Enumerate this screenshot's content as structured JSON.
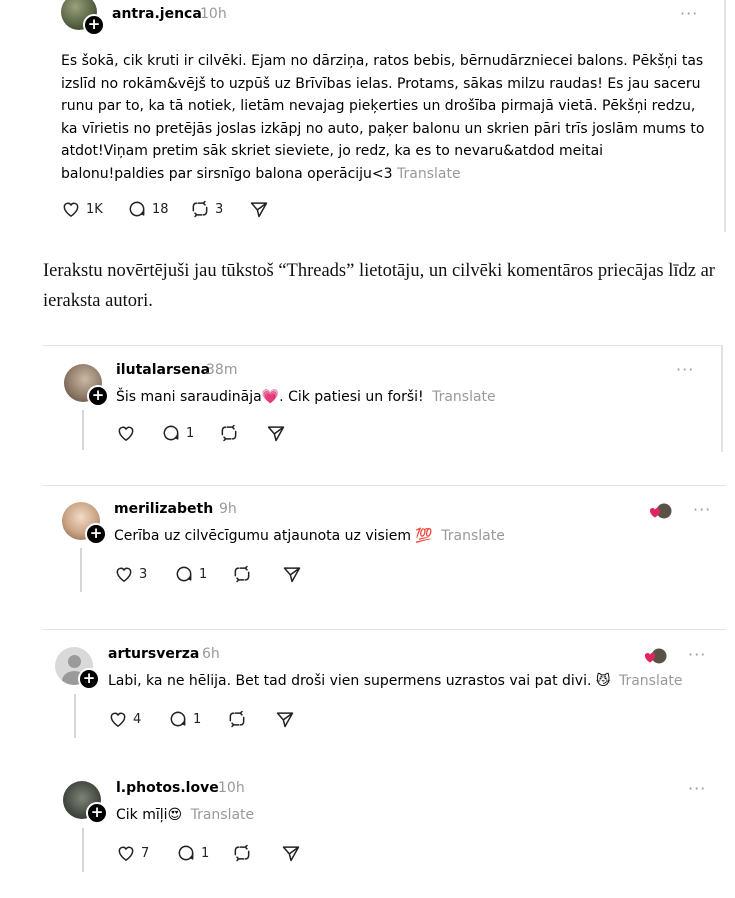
{
  "post": {
    "username": "antra.jenca",
    "time": "10h",
    "text": "Es šokā, cik kruti ir cilvēki. Ejam no dārziņa, ratos bebis, bērnudārzniecei balons. Pēkšņi tas izslīd no rokām&vējš to uzpūš uz Brīvības ielas. Protams, sākas milzu raudas! Es jau saceru runu par to, ka tā notiek, lietām nevajag pieķerties un drošība pirmajā vietā. Pēkšņi redzu, ka vīrietis no pretējās joslas izkāpj no auto, paķer balonu un skrien pāri trīs joslām mums to atdot!Viņam pretim sāk skriet sieviete, jo redz, ka es to nevaru&atdod meitai balonu!paldies par sirsnīgo balona operāciju<3",
    "translate": "Translate",
    "likes": "1K",
    "replies": "18",
    "reposts": "3",
    "more": "···"
  },
  "article_text": "Ierakstu novērtējuši jau tūkstoš “Threads” lietotāju, un cilvēki komentāros priecājas līdz ar ieraksta autori.",
  "comments": [
    {
      "username": "ilutalarsena",
      "time": "38m",
      "text_before": "Šis mani saraudināja",
      "emoji": "💗",
      "text_after": ". Cik patiesi un forši!",
      "translate": "Translate",
      "likes": "",
      "replies": "1",
      "reposts": "",
      "more": "···"
    },
    {
      "username": "merilizabeth",
      "time": "9h",
      "text_before": "Cerība uz cilvēcīgumu atjaunota uz visiem",
      "emoji": "💯",
      "text_after": "",
      "translate": "Translate",
      "likes": "3",
      "replies": "1",
      "reposts": "",
      "more": "···"
    },
    {
      "username": "artursverza",
      "time": "6h",
      "text_before": "Labi, ka ne hēlija. Bet tad droši vien supermens uzrastos vai pat divi.",
      "emoji": "😼",
      "text_after": "",
      "translate": "Translate",
      "likes": "4",
      "replies": "1",
      "reposts": "",
      "more": "···"
    },
    {
      "username": "l.photos.love",
      "time": "10h",
      "text_before": "Cik mīļi",
      "emoji": "😍",
      "text_after": "",
      "translate": "Translate",
      "likes": "7",
      "replies": "1",
      "reposts": "",
      "more": "···"
    }
  ],
  "colors": {
    "secondary_text": "#999999",
    "liked_heart": "#e0245e",
    "divider": "#e3e3e3"
  },
  "icons": {
    "like": "heart-icon",
    "reply": "comment-icon",
    "repost": "repost-icon",
    "share": "share-icon",
    "follow": "plus-icon",
    "more": "more-icon"
  }
}
